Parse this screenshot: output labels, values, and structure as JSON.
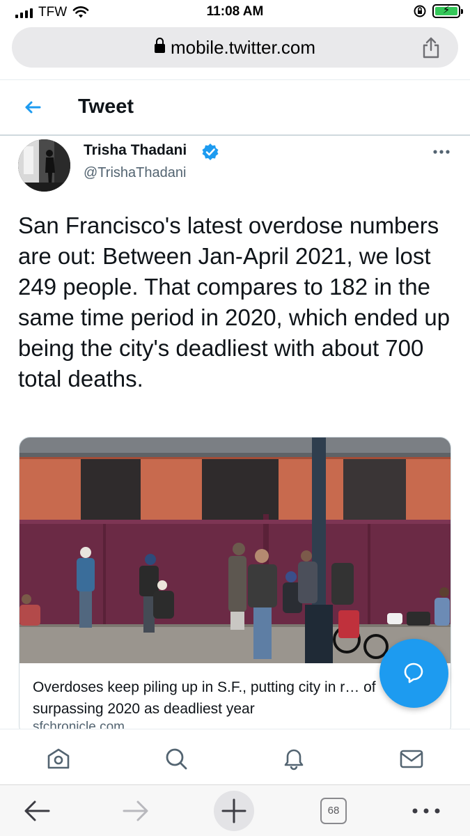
{
  "status": {
    "carrier": "TFW",
    "time": "11:08 AM"
  },
  "browser": {
    "url": "mobile.twitter.com",
    "tabs_count": "68"
  },
  "header": {
    "title": "Tweet"
  },
  "tweet": {
    "author_name": "Trisha Thadani",
    "author_handle": "@TrishaThadani",
    "text": "San Francisco's latest overdose numbers are out: Between Jan-April 2021, we lost 249 people. That compares to 182 in the same time period in 2020, which ended up being the city's deadliest with about 700 total deaths."
  },
  "card": {
    "title": "Overdoses keep piling up in S.F., putting city in r… of surpassing 2020 as deadliest year",
    "domain": "sfchronicle.com"
  },
  "colors": {
    "accent": "#1d9bf0",
    "text": "#0f1419",
    "secondary": "#536471"
  },
  "icons": {
    "tabs": [
      "home-icon",
      "search-icon",
      "notifications-icon",
      "messages-icon"
    ],
    "toolbar": [
      "back-icon",
      "forward-icon",
      "new-tab-icon",
      "tabs-icon",
      "more-icon"
    ]
  }
}
